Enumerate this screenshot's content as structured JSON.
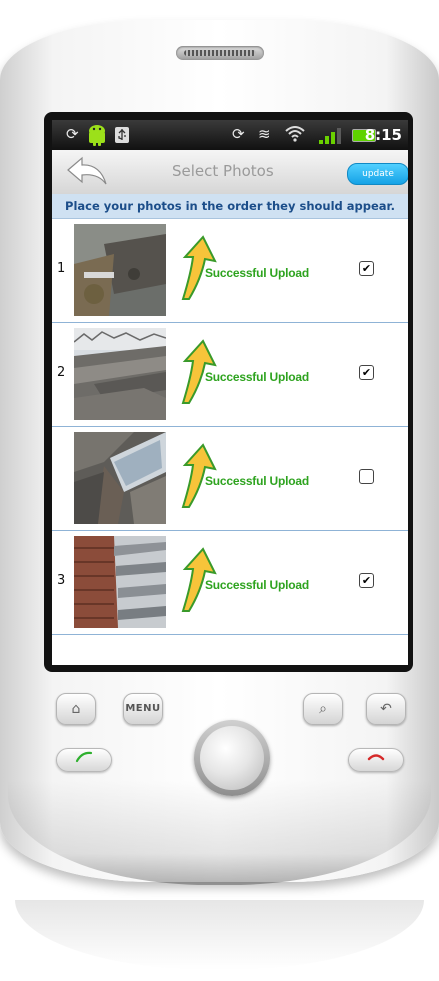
{
  "status_bar": {
    "time": "8:15",
    "icons": [
      "sync-icon",
      "android-icon",
      "usb-icon",
      "sync-icon",
      "vibrate-icon",
      "wifi-icon",
      "signal-icon",
      "battery-icon"
    ]
  },
  "header": {
    "title": "Select Photos",
    "update_label": "update"
  },
  "instructions": "Place your photos in the order they should appear.",
  "rows": [
    {
      "number": "1",
      "status": "Successful Upload",
      "checked": true,
      "check_mark": "✔"
    },
    {
      "number": "2",
      "status": "Successful Upload",
      "checked": true,
      "check_mark": "✔"
    },
    {
      "number": "",
      "status": "Successful Upload",
      "checked": false,
      "check_mark": ""
    },
    {
      "number": "3",
      "status": "Successful Upload",
      "checked": true,
      "check_mark": "✔"
    }
  ],
  "hardware": {
    "menu_label": "MENU",
    "home_icon": "⌂",
    "search_icon": "⌕",
    "back_icon": "↶"
  },
  "colors": {
    "accent_blue": "#15a2e6",
    "instruction_bg": "#cfe1f2",
    "instruction_text": "#1c4e8a",
    "success_green": "#2ea31f",
    "row_divider": "#8fb3d6"
  }
}
